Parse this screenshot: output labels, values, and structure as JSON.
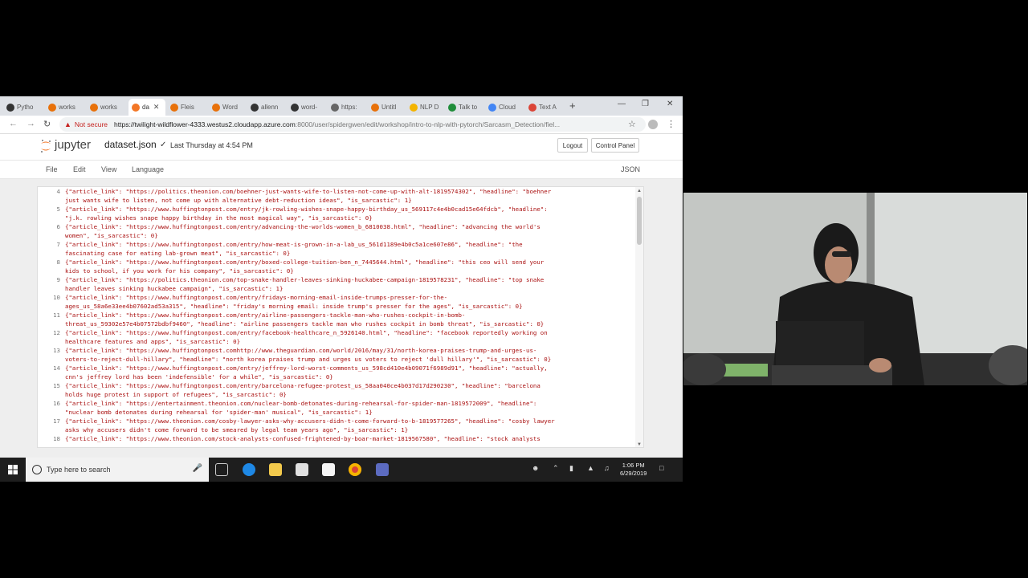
{
  "browser": {
    "tabs": [
      {
        "label": "Pytho",
        "active": false,
        "icon_color": "#333333"
      },
      {
        "label": "works",
        "active": false,
        "icon_color": "#e8710a"
      },
      {
        "label": "works",
        "active": false,
        "icon_color": "#e8710a"
      },
      {
        "label": "da",
        "active": true,
        "icon_color": "#f37726"
      },
      {
        "label": "Fleis",
        "active": false,
        "icon_color": "#e8710a"
      },
      {
        "label": "Word",
        "active": false,
        "icon_color": "#e8710a"
      },
      {
        "label": "allenn",
        "active": false,
        "icon_color": "#333333"
      },
      {
        "label": "word-",
        "active": false,
        "icon_color": "#333333"
      },
      {
        "label": "https:",
        "active": false,
        "icon_color": "#666666"
      },
      {
        "label": "Untitl",
        "active": false,
        "icon_color": "#e8710a"
      },
      {
        "label": "NLP D",
        "active": false,
        "icon_color": "#f4b400"
      },
      {
        "label": "Talk to",
        "active": false,
        "icon_color": "#1f8d3a"
      },
      {
        "label": "Cloud",
        "active": false,
        "icon_color": "#4285f4"
      },
      {
        "label": "Text A",
        "active": false,
        "icon_color": "#db4437"
      }
    ],
    "not_secure": "Not secure",
    "url_host": "https://twilight-wildflower-4333.westus2.cloudapp.azure.com",
    "url_rest": ":8000/user/spidergwen/edit/workshop/intro-to-nlp-with-pytorch/Sarcasm_Detection/fiel..."
  },
  "jupyter": {
    "logo_text": "jupyter",
    "filename": "dataset.json",
    "saved": "Last Thursday at 4:54 PM",
    "logout": "Logout",
    "control_panel": "Control Panel",
    "menu": [
      "File",
      "Edit",
      "View",
      "Language"
    ],
    "mode": "JSON"
  },
  "editor": {
    "lines": [
      {
        "n": "4",
        "text": "{\"article_link\": \"https://politics.theonion.com/boehner-just-wants-wife-to-listen-not-come-up-with-alt-1819574302\", \"headline\": \"boehner"
      },
      {
        "n": "",
        "text": "just wants wife to listen, not come up with alternative debt-reduction ideas\", \"is_sarcastic\": 1}"
      },
      {
        "n": "5",
        "text": "{\"article_link\": \"https://www.huffingtonpost.com/entry/jk-rowling-wishes-snape-happy-birthday_us_569117c4e4b0cad15e64fdcb\", \"headline\":"
      },
      {
        "n": "",
        "text": "\"j.k. rowling wishes snape happy birthday in the most magical way\", \"is_sarcastic\": 0}"
      },
      {
        "n": "6",
        "text": "{\"article_link\": \"https://www.huffingtonpost.com/entry/advancing-the-worlds-women_b_6810038.html\", \"headline\": \"advancing the world's"
      },
      {
        "n": "",
        "text": "women\", \"is_sarcastic\": 0}"
      },
      {
        "n": "7",
        "text": "{\"article_link\": \"https://www.huffingtonpost.com/entry/how-meat-is-grown-in-a-lab_us_561d1189e4b0c5a1ce607e86\", \"headline\": \"the"
      },
      {
        "n": "",
        "text": "fascinating case for eating lab-grown meat\", \"is_sarcastic\": 0}"
      },
      {
        "n": "8",
        "text": "{\"article_link\": \"https://www.huffingtonpost.com/entry/boxed-college-tuition-ben_n_7445644.html\", \"headline\": \"this ceo will send your"
      },
      {
        "n": "",
        "text": "kids to school, if you work for his company\", \"is_sarcastic\": 0}"
      },
      {
        "n": "9",
        "text": "{\"article_link\": \"https://politics.theonion.com/top-snake-handler-leaves-sinking-huckabee-campaign-1819578231\", \"headline\": \"top snake"
      },
      {
        "n": "",
        "text": "handler leaves sinking huckabee campaign\", \"is_sarcastic\": 1}"
      },
      {
        "n": "10",
        "text": "{\"article_link\": \"https://www.huffingtonpost.com/entry/fridays-morning-email-inside-trumps-presser-for-the-"
      },
      {
        "n": "",
        "text": "ages_us_58a6e33ee4b07602ad53a315\", \"headline\": \"friday's morning email: inside trump's presser for the ages\", \"is_sarcastic\": 0}"
      },
      {
        "n": "11",
        "text": "{\"article_link\": \"https://www.huffingtonpost.com/entry/airline-passengers-tackle-man-who-rushes-cockpit-in-bomb-"
      },
      {
        "n": "",
        "text": "threat_us_59302e57e4b07572bdbf9460\", \"headline\": \"airline passengers tackle man who rushes cockpit in bomb threat\", \"is_sarcastic\": 0}"
      },
      {
        "n": "12",
        "text": "{\"article_link\": \"https://www.huffingtonpost.com/entry/facebook-healthcare_n_5926140.html\", \"headline\": \"facebook reportedly working on"
      },
      {
        "n": "",
        "text": "healthcare features and apps\", \"is_sarcastic\": 0}"
      },
      {
        "n": "13",
        "text": "{\"article_link\": \"https://www.huffingtonpost.comhttp://www.theguardian.com/world/2016/may/31/north-korea-praises-trump-and-urges-us-"
      },
      {
        "n": "",
        "text": "voters-to-reject-dull-hillary\", \"headline\": \"north korea praises trump and urges us voters to reject 'dull hillary'\", \"is_sarcastic\": 0}"
      },
      {
        "n": "14",
        "text": "{\"article_link\": \"https://www.huffingtonpost.com/entry/jeffrey-lord-worst-comments_us_598cd410e4b09071f6989d91\", \"headline\": \"actually,"
      },
      {
        "n": "",
        "text": "cnn's jeffrey lord has been 'indefensible' for a while\", \"is_sarcastic\": 0}"
      },
      {
        "n": "15",
        "text": "{\"article_link\": \"https://www.huffingtonpost.com/entry/barcelona-refugee-protest_us_58aa040ce4b037d17d290230\", \"headline\": \"barcelona"
      },
      {
        "n": "",
        "text": "holds huge protest in support of refugees\", \"is_sarcastic\": 0}"
      },
      {
        "n": "16",
        "text": "{\"article_link\": \"https://entertainment.theonion.com/nuclear-bomb-detonates-during-rehearsal-for-spider-man-1819572009\", \"headline\":"
      },
      {
        "n": "",
        "text": "\"nuclear bomb detonates during rehearsal for 'spider-man' musical\", \"is_sarcastic\": 1}"
      },
      {
        "n": "17",
        "text": "{\"article_link\": \"https://www.theonion.com/cosby-lawyer-asks-why-accusers-didn-t-come-forward-to-b-1819577265\", \"headline\": \"cosby lawyer"
      },
      {
        "n": "",
        "text": "asks why accusers didn't come forward to be smeared by legal team years ago\", \"is_sarcastic\": 1}"
      },
      {
        "n": "18",
        "text": "{\"article_link\": \"https://www.theonion.com/stock-analysts-confused-frightened-by-boar-market-1819567580\", \"headline\": \"stock analysts"
      }
    ]
  },
  "taskbar": {
    "search_placeholder": "Type here to search",
    "time": "1:06 PM",
    "date": "6/29/2019"
  }
}
